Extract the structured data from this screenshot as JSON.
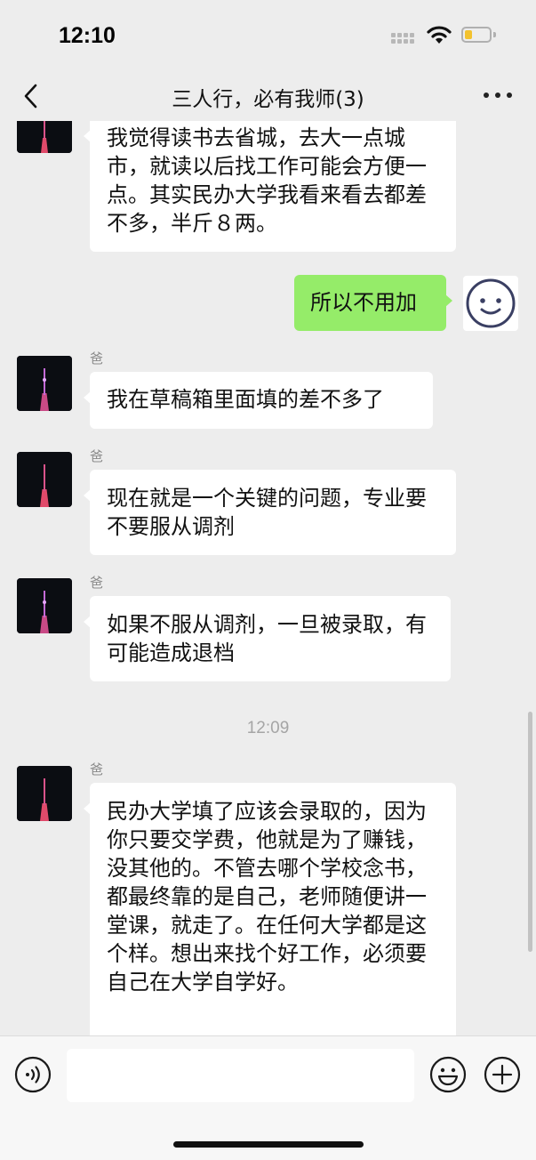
{
  "status_bar": {
    "time": "12:10",
    "battery_level": 0.3
  },
  "header": {
    "title": "三人行，必有我师(3)"
  },
  "messages": [
    {
      "sender": "",
      "text": "我觉得读书去省城，去大一点城市，就读以后找工作可能会方便一点。其实民办大学我看来看去都差不多，半斤８两。"
    },
    {
      "text": "所以不用加"
    },
    {
      "sender": "爸",
      "text": "我在草稿箱里面填的差不多了"
    },
    {
      "sender": "爸",
      "text": "现在就是一个关键的问题，专业要不要服从调剂"
    },
    {
      "sender": "爸",
      "text": "如果不服从调剂，一旦被录取，有可能造成退档"
    },
    {
      "sender": "爸",
      "text": "民办大学填了应该会录取的，因为你只要交学费，他就是为了赚钱，没其他的。不管去哪个学校念书，都最终靠的是自己，老师随便讲一堂课，就走了。在任何大学都是这个样。想出来找个好工作，必须要自己在大学自学好。"
    }
  ],
  "timestamp": "12:09",
  "input": {
    "value": ""
  },
  "icons": {
    "back": "chevron-left-icon",
    "more": "more-dots-icon",
    "voice": "voice-icon",
    "emoji": "emoji-icon",
    "plus": "plus-icon"
  },
  "colors": {
    "my_bubble": "#95ec69",
    "their_bubble": "#ffffff",
    "background": "#ededed"
  }
}
